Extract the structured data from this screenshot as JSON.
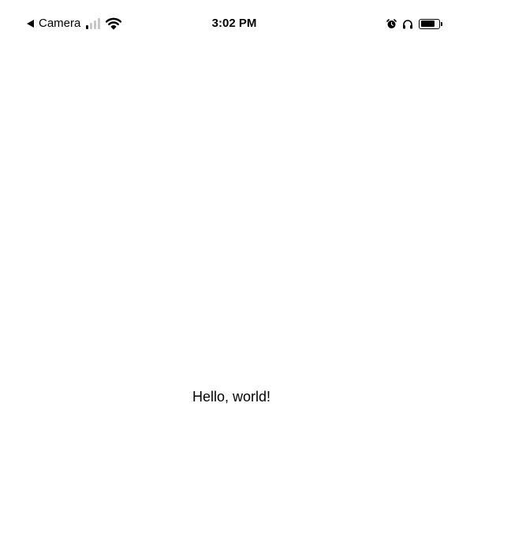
{
  "status_bar": {
    "back_label": "Camera",
    "time": "3:02 PM",
    "signal_bars_total": 4,
    "signal_bars_active": 1,
    "battery_level": 0.85,
    "icons": [
      "back-arrow-icon",
      "signal-icon",
      "wifi-icon",
      "alarm-icon",
      "headphones-icon",
      "battery-icon"
    ]
  },
  "main": {
    "greeting": "Hello, world!"
  },
  "colors": {
    "background": "#ffffff",
    "text": "#000000",
    "inactive_signal": "#c7c7c7"
  }
}
